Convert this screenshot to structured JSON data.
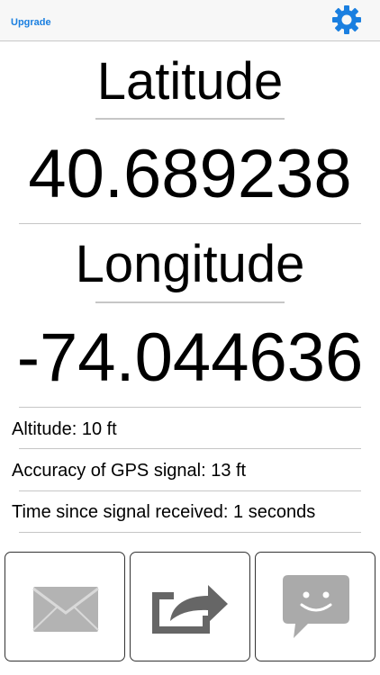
{
  "header": {
    "upgrade_label": "Upgrade",
    "settings_icon": "gear-icon",
    "accent_color": "#1a7fe0"
  },
  "coordinates": {
    "latitude_label": "Latitude",
    "latitude_value": "40.689238",
    "longitude_label": "Longitude",
    "longitude_value": "-74.044636"
  },
  "details": {
    "altitude": "Altitude: 10 ft",
    "accuracy": "Accuracy of GPS signal:  13 ft",
    "time_since": "Time since signal received: 1 seconds"
  },
  "actions": {
    "email_icon": "envelope-icon",
    "share_icon": "share-icon",
    "message_icon": "message-bubble-icon"
  }
}
